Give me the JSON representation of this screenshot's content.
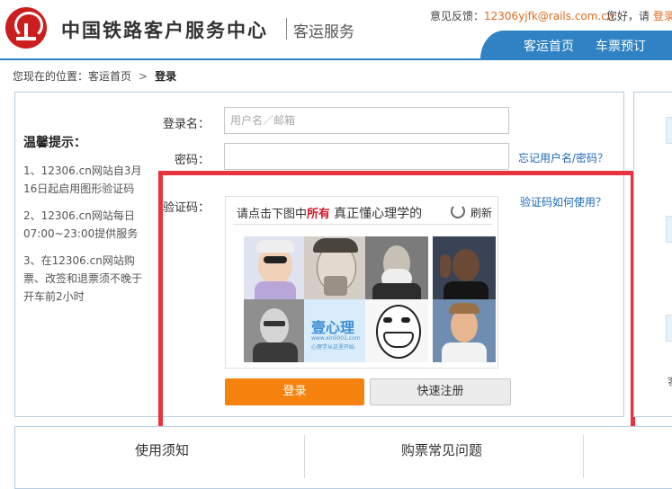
{
  "header": {
    "title": "中国铁路客户服务中心",
    "subtitle": "客运服务",
    "feedback_label": "意见反馈：",
    "feedback_email": "12306yjfk@rails.com.cn",
    "greeting": "您好，请",
    "login_link": "登录",
    "nav": {
      "home": "客运首页",
      "ticket": "车票预订"
    }
  },
  "breadcrumb": {
    "prefix": "您现在的位置：",
    "home": "客运首页",
    "separator": ">",
    "current": "登录"
  },
  "tips": {
    "title": "温馨提示：",
    "items": [
      "1、12306.cn网站自3月16日起启用图形验证码",
      "2、12306.cn网站每日07:00~23:00提供服务",
      "3、在12306.cn网站购票、改签和退票须不晚于开车前2小时"
    ]
  },
  "form": {
    "username_label": "登录名：",
    "username_placeholder": "用户名／邮箱",
    "password_label": "密码：",
    "captcha_label": "验证码：",
    "forgot_link": "忘记用户名/密码？",
    "captcha_help_link": "验证码如何使用？"
  },
  "captcha": {
    "prompt_before": "请点击下图中",
    "prompt_highlight": "所有",
    "prompt_after": "真正懂心理学的",
    "refresh_label": "刷新",
    "logo_text": "壹心理",
    "logo_url": "www.xinli001.com",
    "logo_tagline": "心理学从这里开始"
  },
  "buttons": {
    "login": "登录",
    "register": "快速注册"
  },
  "bottom": {
    "notice_title": "使用须知",
    "faq_title": "购票常见问题"
  },
  "right_panel": {
    "partial_text": "客"
  },
  "colors": {
    "brand_blue": "#2f83c4",
    "accent_orange": "#f7830f",
    "highlight_red": "#e8323e",
    "link_blue": "#1a67b8"
  }
}
